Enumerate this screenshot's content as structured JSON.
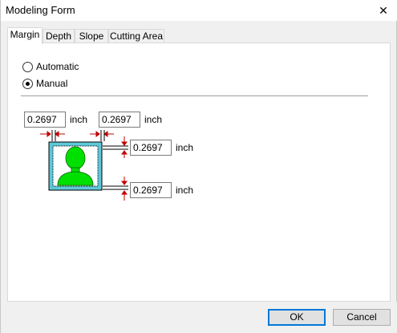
{
  "window": {
    "title": "Modeling Form",
    "close_symbol": "✕"
  },
  "tabs": [
    {
      "label": "Margin",
      "active": true
    },
    {
      "label": "Depth",
      "active": false
    },
    {
      "label": "Slope",
      "active": false
    },
    {
      "label": "Cutting Area",
      "active": false
    }
  ],
  "mode": {
    "options": [
      {
        "label": "Automatic",
        "selected": false
      },
      {
        "label": "Manual",
        "selected": true
      }
    ]
  },
  "margins": {
    "left": {
      "value": "0.2697",
      "unit": "inch"
    },
    "right": {
      "value": "0.2697",
      "unit": "inch"
    },
    "top": {
      "value": "0.2697",
      "unit": "inch"
    },
    "bottom": {
      "value": "0.2697",
      "unit": "inch"
    }
  },
  "buttons": {
    "ok": "OK",
    "cancel": "Cancel"
  },
  "colors": {
    "frame_fill": "#5ec8d8",
    "person": "#00e000",
    "arrow": "#c00000",
    "focus": "#0078d7"
  },
  "icons": {
    "close": "close-icon",
    "preview": "person-silhouette-icon"
  }
}
